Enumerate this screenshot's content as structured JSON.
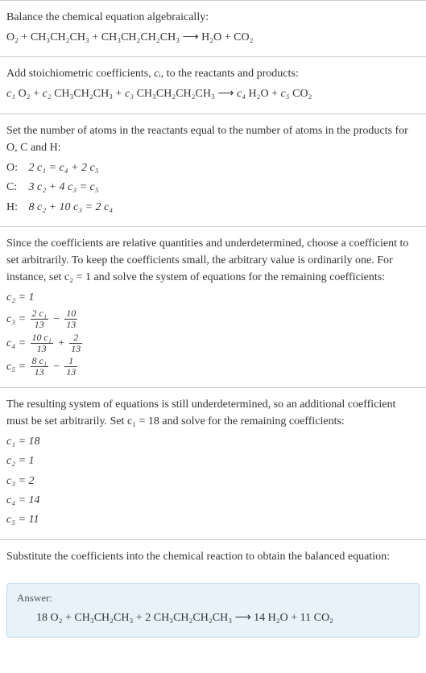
{
  "section1": {
    "title": "Balance the chemical equation algebraically:",
    "eq": "O₂ + CH₃CH₂CH₃ + CH₃CH₂CH₂CH₃  ⟶  H₂O + CO₂"
  },
  "section2": {
    "title_a": "Add stoichiometric coefficients, ",
    "title_sym": "cᵢ",
    "title_b": ", to the reactants and products:",
    "eq_c1": "c₁",
    "eq_s1": " O₂ + ",
    "eq_c2": "c₂",
    "eq_s2": " CH₃CH₂CH₃ + ",
    "eq_c3": "c₃",
    "eq_s3": " CH₃CH₂CH₂CH₃  ⟶  ",
    "eq_c4": "c₄",
    "eq_s4": " H₂O + ",
    "eq_c5": "c₅",
    "eq_s5": " CO₂"
  },
  "section3": {
    "title": "Set the number of atoms in the reactants equal to the number of atoms in the products for O, C and H:",
    "rows": {
      "O": {
        "label": "O: ",
        "eq": "2 c₁ = c₄ + 2 c₅"
      },
      "C": {
        "label": "C: ",
        "eq": "3 c₂ + 4 c₃ = c₅"
      },
      "H": {
        "label": "H: ",
        "eq": "8 c₂ + 10 c₃ = 2 c₄"
      }
    }
  },
  "section4": {
    "title": "Since the coefficients are relative quantities and underdetermined, choose a coefficient to set arbitrarily. To keep the coefficients small, the arbitrary value is ordinarily one. For instance, set c₂ = 1 and solve the system of equations for the remaining coefficients:",
    "c2_lhs": "c₂ = ",
    "c2_rhs": "1",
    "c3_lhs": "c₃ = ",
    "c3_f1_num": "2 c₁",
    "c3_f1_den": "13",
    "c3_mid": " − ",
    "c3_f2_num": "10",
    "c3_f2_den": "13",
    "c4_lhs": "c₄ = ",
    "c4_f1_num": "10 c₁",
    "c4_f1_den": "13",
    "c4_mid": " + ",
    "c4_f2_num": "2",
    "c4_f2_den": "13",
    "c5_lhs": "c₅ = ",
    "c5_f1_num": "8 c₁",
    "c5_f1_den": "13",
    "c5_mid": " − ",
    "c5_f2_num": "1",
    "c5_f2_den": "13"
  },
  "section5": {
    "title": "The resulting system of equations is still underdetermined, so an additional coefficient must be set arbitrarily. Set c₁ = 18 and solve for the remaining coefficients:",
    "rows": {
      "c1": "c₁ = 18",
      "c2": "c₂ = 1",
      "c3": "c₃ = 2",
      "c4": "c₄ = 14",
      "c5": "c₅ = 11"
    }
  },
  "section6": {
    "title": "Substitute the coefficients into the chemical reaction to obtain the balanced equation:"
  },
  "answer": {
    "label": "Answer:",
    "eq": "18 O₂ + CH₃CH₂CH₃ + 2 CH₃CH₂CH₂CH₃  ⟶  14 H₂O + 11 CO₂"
  },
  "chart_data": {
    "type": "table",
    "title": "Balancing O₂ + C₃H₈ + C₄H₁₀ → H₂O + CO₂",
    "atom_balance": [
      {
        "element": "O",
        "equation": "2 c1 = c4 + 2 c5"
      },
      {
        "element": "C",
        "equation": "3 c2 + 4 c3 = c5"
      },
      {
        "element": "H",
        "equation": "8 c2 + 10 c3 = 2 c4"
      }
    ],
    "parametric_with_c2_1": {
      "c2": 1,
      "c3": "(2 c1)/13 − 10/13",
      "c4": "(10 c1)/13 + 2/13",
      "c5": "(8 c1)/13 − 1/13"
    },
    "solution_c1_18": {
      "c1": 18,
      "c2": 1,
      "c3": 2,
      "c4": 14,
      "c5": 11
    },
    "balanced_equation": "18 O2 + CH3CH2CH3 + 2 CH3CH2CH2CH3 → 14 H2O + 11 CO2"
  }
}
